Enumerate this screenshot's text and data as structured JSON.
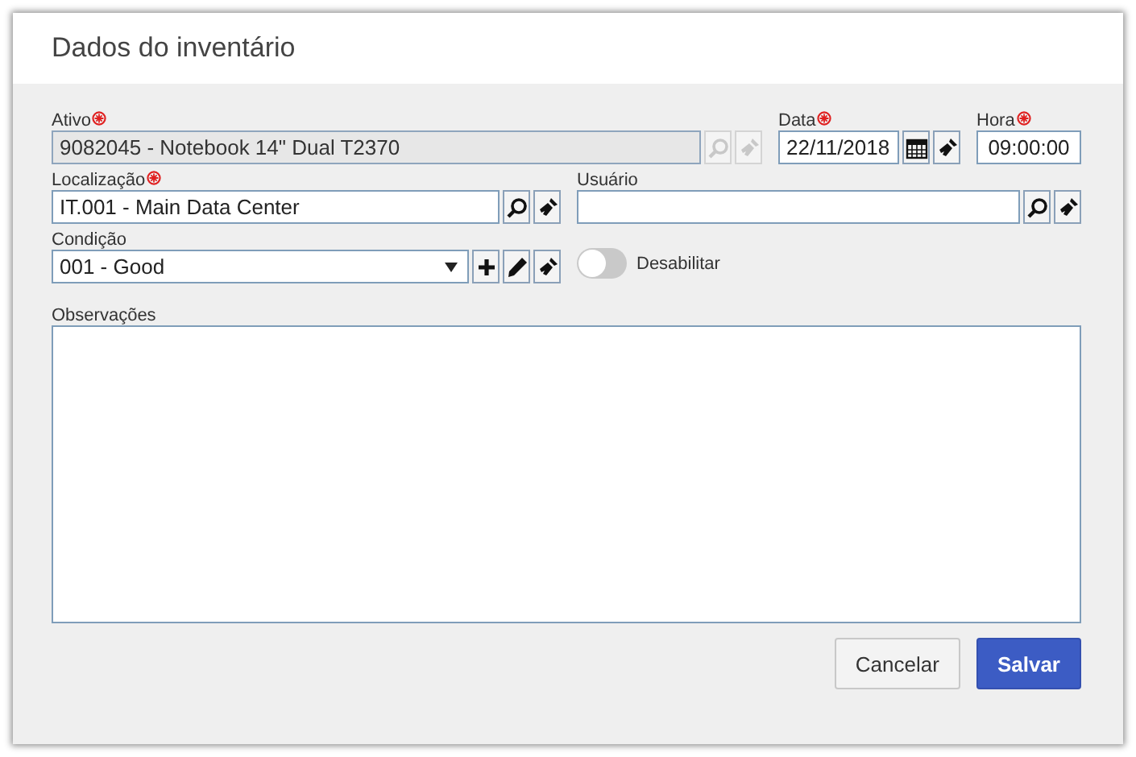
{
  "window": {
    "title": "Dados do inventário"
  },
  "row_1": [
    {
      "label": "Ativo",
      "required": true,
      "value": "9082045 - Notebook 14\" Dual T2370",
      "disabled": true,
      "tools": [
        {
          "kind": "search"
        },
        {
          "kind": "clear"
        }
      ]
    },
    {
      "label": "Data",
      "required": true,
      "value": "22/11/2018",
      "disabled": false,
      "tools": [
        {
          "kind": "calendar"
        },
        {
          "kind": "clear"
        }
      ]
    },
    {
      "label": "Hora",
      "required": true,
      "value": "09:00:00",
      "disabled": false
    }
  ],
  "row_2": [
    {
      "label": "Localização",
      "required": true,
      "value": "IT.001 - Main Data Center",
      "disabled": false,
      "tools": [
        {
          "kind": "search"
        },
        {
          "kind": "clear"
        }
      ]
    },
    {
      "label": "Usuário",
      "required": false,
      "disabled": false,
      "tools": [
        {
          "kind": "search"
        },
        {
          "kind": "clear"
        }
      ]
    }
  ],
  "condition": {
    "label": "Condição",
    "required": false,
    "value": "001 - Good",
    "tools": [
      {
        "kind": "add"
      },
      {
        "kind": "edit"
      },
      {
        "kind": "clear"
      }
    ]
  },
  "disable_toggle": {
    "label": "Desabilitar",
    "on": false
  },
  "notes": {
    "label": "Observações"
  },
  "buttons": [
    {
      "label": "Cancelar",
      "kind": "secondary"
    },
    {
      "label": "Salvar",
      "kind": "primary"
    }
  ]
}
